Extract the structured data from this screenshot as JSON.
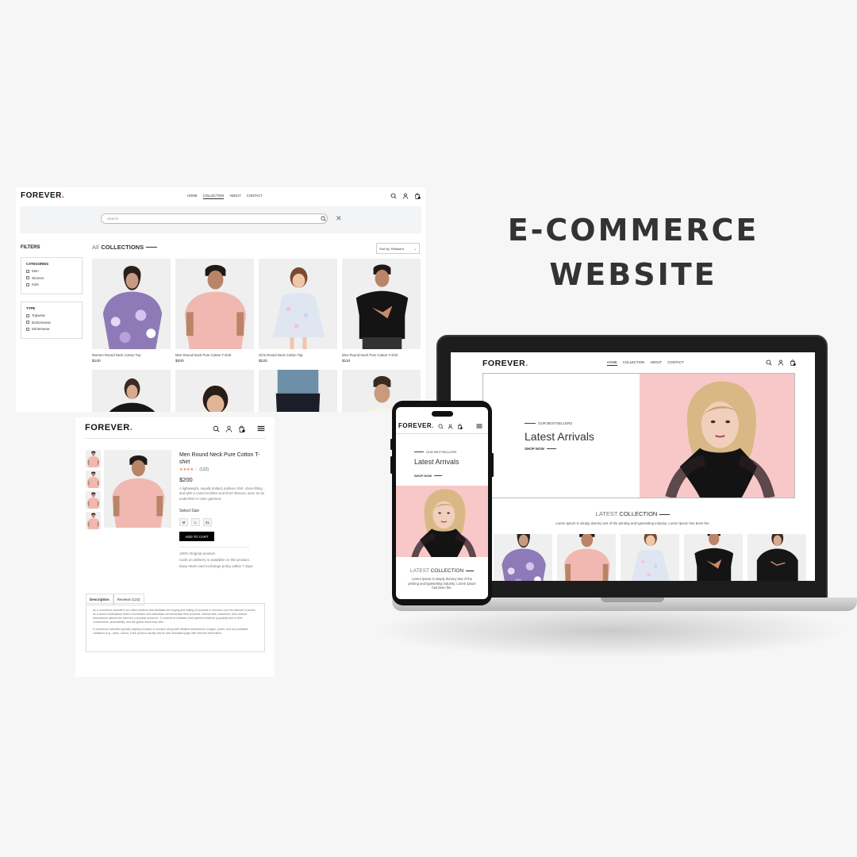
{
  "brand": {
    "logo_text": "FOREVER",
    "logo_dot": ".",
    "accent": "#e11d48"
  },
  "heading": {
    "line1": "E-COMMERCE",
    "line2": "WEBSITE"
  },
  "collection_page": {
    "nav": {
      "home": "HOME",
      "collection": "COLLECTION",
      "about": "ABOUT",
      "contact": "CONTACT"
    },
    "search_placeholder": "Search",
    "filters_title": "FILTERS",
    "categories": {
      "title": "CATEGORIES",
      "options": [
        "Men",
        "Women",
        "Kids"
      ]
    },
    "type": {
      "title": "TYPE",
      "options": [
        "Topwear",
        "Bottomwear",
        "Winterwear"
      ]
    },
    "all_collections": {
      "prefix": "All",
      "main": "COLLECTIONS"
    },
    "sort_label": "Sort by: Relavent",
    "products": [
      {
        "name": "Women Round Neck Cotton Top",
        "price": "$100"
      },
      {
        "name": "Men Round Neck Pure Cotton T-shirt",
        "price": "$200"
      },
      {
        "name": "Girls Round Neck Cotton Top",
        "price": "$220"
      },
      {
        "name": "Men Round Neck Pure Cotton T-shirt",
        "price": "$110"
      }
    ]
  },
  "product_page": {
    "title": "Men Round Neck Pure Cotton T-shirt",
    "rating_stars": 4,
    "rating_count": "(122)",
    "price": "$200",
    "description": "A lightweight, usually knitted, pullover shirt, close-fitting and with a round neckline and short sleeves, worn as an undershirt or outer garment.",
    "select_size_label": "Select Size",
    "sizes": [
      "M",
      "L",
      "XL"
    ],
    "add_to_cart": "ADD TO CART",
    "policy": [
      "100% Original product.",
      "Cash on delivery is available on this product.",
      "Easy return and exchange policy within 7 days."
    ],
    "tabs": {
      "description": "Description",
      "reviews": "Reviews (122)"
    },
    "desc_p1": "An e-commerce website is an online platform that facilitates the buying and selling of products or services over the internet. It serves as a virtual marketplace where businesses and individuals can showcase their products, interact with customers, and conduct transactions without the need for a physical presence. E-commerce websites have gained immense popularity due to their convenience, accessibility, and the global reach they offer.",
    "desc_p2": "E-commerce websites typically display products or services along with detailed descriptions, images, prices, and any available variations (e.g., sizes, colors). Each product usually has its own dedicated page with relevant information."
  },
  "laptop_page": {
    "nav": {
      "home": "HOME",
      "collection": "COLLECTION",
      "about": "ABOUT",
      "contact": "CONTACT"
    },
    "hero": {
      "eyebrow": "OUR BESTSELLERS",
      "headline": "Latest Arrivals",
      "cta": "SHOP NOW",
      "bg_color": "#f8c8c8"
    },
    "latest_collection": {
      "prefix": "LATEST",
      "main": "COLLECTION",
      "subtitle": "Lorem Ipsum is simply dummy text of the printing and typesetting industry. Lorem Ipsum has been the."
    }
  },
  "phone_page": {
    "hero": {
      "eyebrow": "OUR BESTSELLERS",
      "headline": "Latest Arrivals",
      "cta": "SHOP NOW"
    },
    "latest_collection": {
      "prefix": "LATEST",
      "main": "COLLECTION",
      "subtitle": "Lorem Ipsum is simply dummy text of the printing and typesetting industry. Lorem Ipsum has been the."
    }
  }
}
